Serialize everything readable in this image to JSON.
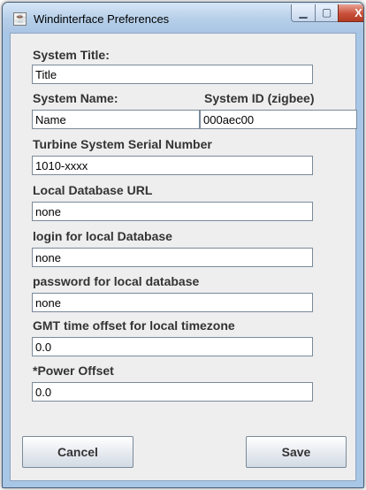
{
  "window": {
    "title": "Windinterface Preferences",
    "controls": {
      "minimize": "▁",
      "maximize": "▢",
      "close": "X"
    }
  },
  "form": {
    "system_title": {
      "label": "System Title:",
      "value": "Title"
    },
    "system_name": {
      "label": "System Name:",
      "value": "Name"
    },
    "system_id": {
      "label": "System ID (zigbee)",
      "value": "000aec00"
    },
    "serial_number": {
      "label": "Turbine System Serial Number",
      "value": "1010-xxxx"
    },
    "db_url": {
      "label": "Local Database URL",
      "value": "none"
    },
    "db_login": {
      "label": "login for local Database",
      "value": "none"
    },
    "db_password": {
      "label": "password for local database",
      "value": "none"
    },
    "gmt_offset": {
      "label": "GMT time offset for local timezone",
      "value": "0.0"
    },
    "power_offset": {
      "label": "*Power Offset",
      "value": "0.0"
    }
  },
  "buttons": {
    "cancel": "Cancel",
    "save": "Save"
  }
}
